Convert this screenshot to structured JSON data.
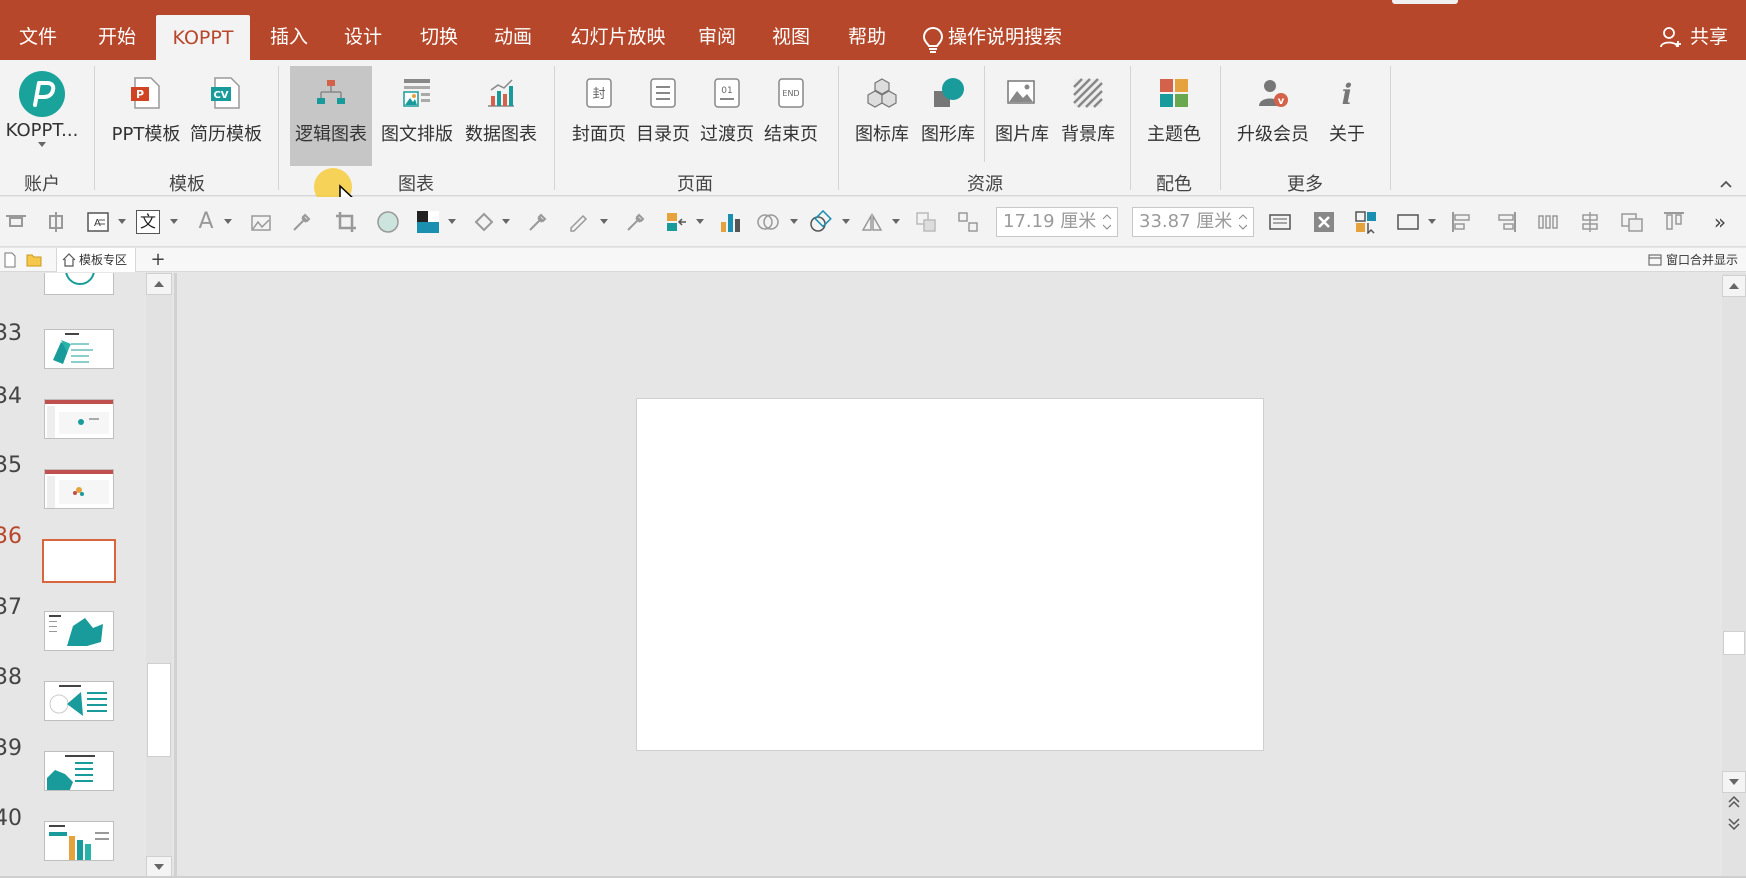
{
  "tabs": [
    "文件",
    "开始",
    "KOPPT",
    "插入",
    "设计",
    "切换",
    "动画",
    "幻灯片放映",
    "审阅",
    "视图",
    "帮助"
  ],
  "active_tab": "KOPPT",
  "search_label": "操作说明搜索",
  "share_label": "共享",
  "ribbon": {
    "account": {
      "button": "KOPPT...",
      "group": "账户"
    },
    "template": {
      "ppt": "PPT模板",
      "resume": "简历模板",
      "group": "模板"
    },
    "chart": {
      "logic": "逻辑图表",
      "layout": "图文排版",
      "data": "数据图表",
      "group": "图表"
    },
    "page": {
      "cover": "封面页",
      "toc": "目录页",
      "transition": "过渡页",
      "end": "结束页",
      "group": "页面"
    },
    "resource": {
      "icons": "图标库",
      "shapes": "图形库",
      "pictures": "图片库",
      "backgrounds": "背景库",
      "group": "资源"
    },
    "color": {
      "theme": "主题色",
      "group": "配色"
    },
    "more": {
      "upgrade": "升级会员",
      "about": "关于",
      "group": "更多"
    },
    "icon_text": {
      "ppt": "P",
      "cv": "CV",
      "cover": "封",
      "toc": "☰",
      "transition": "01",
      "end": "END",
      "info": "i",
      "vip": "v"
    }
  },
  "toolbar": {
    "height_value": "17.19 厘米",
    "width_value": "33.87 厘米",
    "text_icon_char": "文",
    "font_icon_char": "A",
    "more_icon_char": "»"
  },
  "doc_tabs": {
    "template_zone": "模板专区",
    "add": "+",
    "merge_view": "窗口合并显示"
  },
  "slides": {
    "numbers": [
      "33",
      "34",
      "35",
      "36",
      "37",
      "38",
      "39",
      "40"
    ],
    "active": "36"
  },
  "colors": {
    "accent": "#b7472a",
    "ribbon_bg": "#f3f3f3",
    "teal": "#1a9b9b",
    "active_slide_border": "#d7663f"
  }
}
